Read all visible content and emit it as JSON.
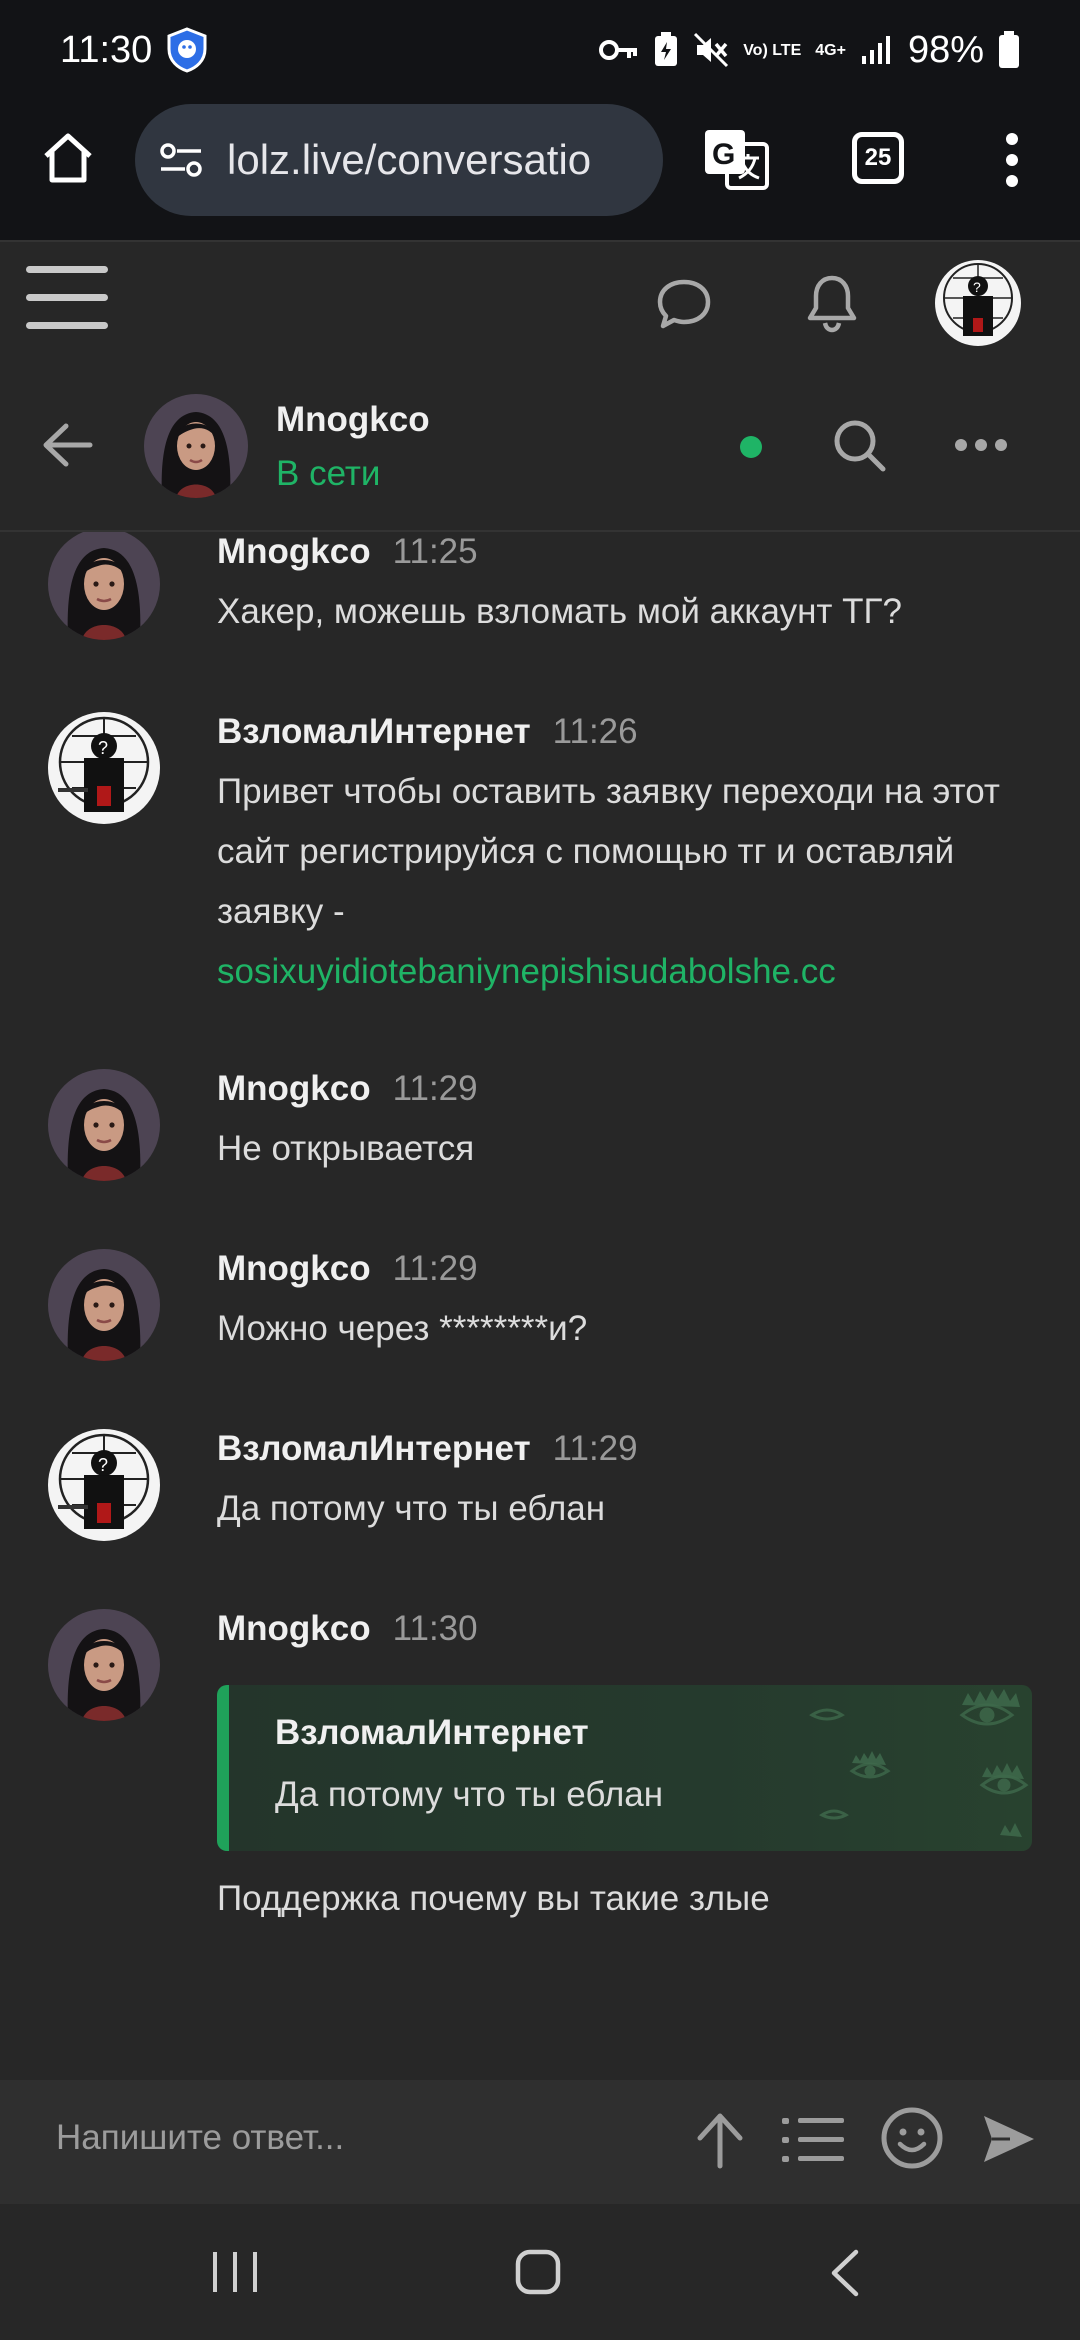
{
  "status_bar": {
    "time": "11:30",
    "volte": "Vo) LTE",
    "network": "4G+",
    "battery": "98%"
  },
  "browser": {
    "url": "lolz.live/conversatio",
    "tab_count": "25"
  },
  "conversation": {
    "partner_name": "Mnogkco",
    "partner_status": "В сети"
  },
  "messages": [
    {
      "author": "Mnogkco",
      "time": "11:25",
      "text": "Хакер, можешь взломать мой аккаунт ТГ?"
    },
    {
      "author": "ВзломалИнтернет",
      "time": "11:26",
      "text": "Привет чтобы оставить заявку переходи на этот сайт регистрируйся с помощью тг и оставляй заявку -",
      "link": "sosixuyidiotebaniynepishisudabolshe.cc"
    },
    {
      "author": "Mnogkco",
      "time": "11:29",
      "text": "Не открывается"
    },
    {
      "author": "Mnogkco",
      "time": "11:29",
      "text": "Можно через ********и?"
    },
    {
      "author": "ВзломалИнтернет",
      "time": "11:29",
      "text": "Да потому что ты еблан"
    },
    {
      "author": "Mnogkco",
      "time": "11:30",
      "quote_author": "ВзломалИнтернет",
      "quote_text": "Да потому что ты еблан",
      "text": "Поддержка почему вы такие злые"
    }
  ],
  "reply_box": {
    "placeholder": "Напишите ответ..."
  },
  "colors": {
    "accent": "#1fb466",
    "background": "#272727",
    "quote_border": "#1fa25a"
  }
}
